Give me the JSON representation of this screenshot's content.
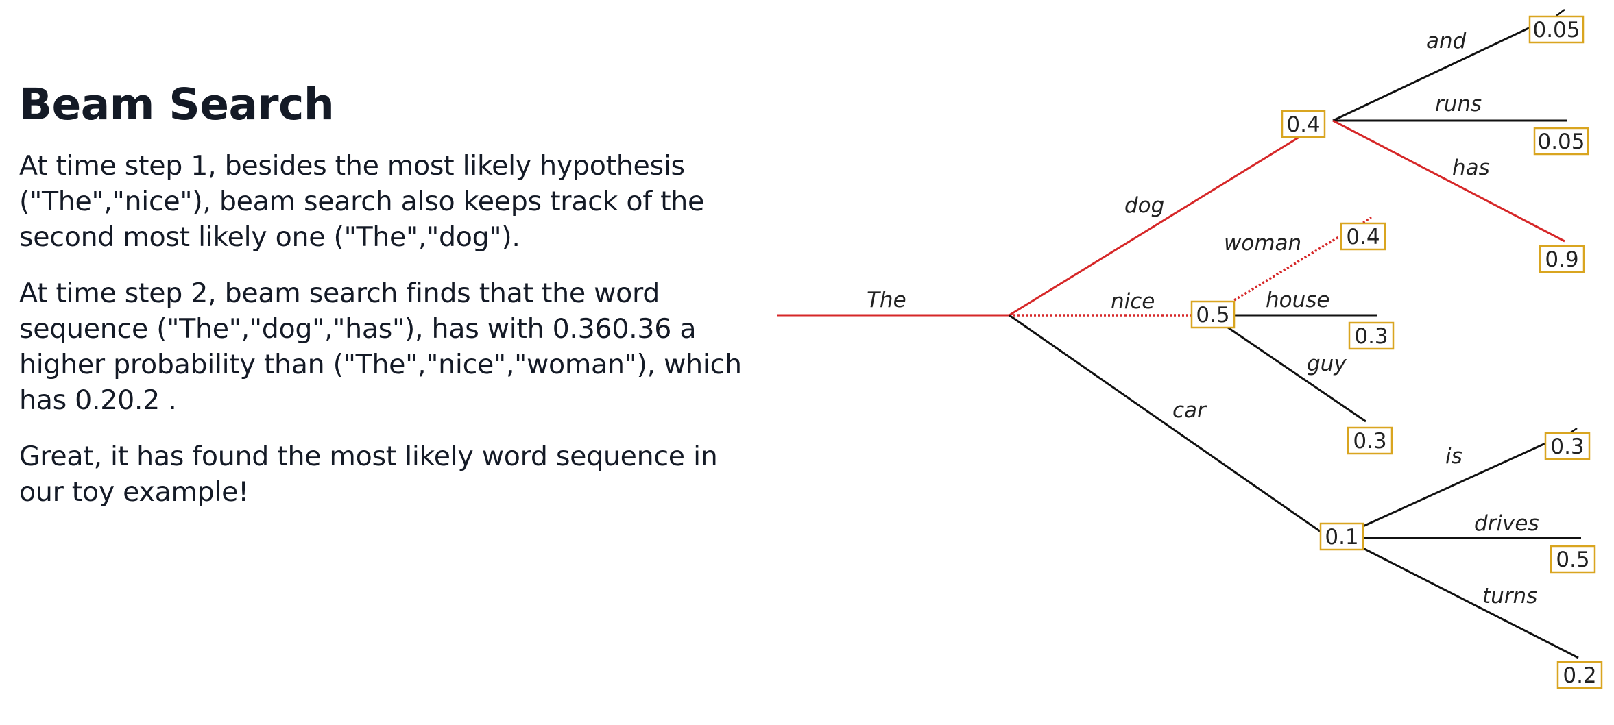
{
  "heading": "Beam Search",
  "paragraphs": [
    "At time step 1, besides the most likely hypothesis (\"The\",\"nice\"), beam search also keeps track of the second most likely one (\"The\",\"dog\").",
    "At time step 2, beam search finds that the word sequence (\"The\",\"dog\",\"has\"), has with 0.360.36 a higher probability than (\"The\",\"nice\",\"woman\"), which has 0.20.2 .",
    "Great, it has found the most likely word sequence in our toy example!"
  ],
  "tree": {
    "colors": {
      "chosen": "#d62728",
      "other": "#111111",
      "box_border": "#d9a520"
    },
    "root": {
      "word": "The"
    },
    "level1": [
      {
        "word": "dog",
        "prob": "0.4"
      },
      {
        "word": "nice",
        "prob": "0.5"
      },
      {
        "word": "car",
        "prob": "0.1"
      }
    ],
    "level2": {
      "dog": [
        {
          "word": "and",
          "prob": "0.05"
        },
        {
          "word": "runs",
          "prob": "0.05"
        },
        {
          "word": "has",
          "prob": "0.9"
        }
      ],
      "nice": [
        {
          "word": "woman",
          "prob": "0.4"
        },
        {
          "word": "house",
          "prob": "0.3"
        },
        {
          "word": "guy",
          "prob": "0.3"
        }
      ],
      "car": [
        {
          "word": "is",
          "prob": "0.3"
        },
        {
          "word": "drives",
          "prob": "0.5"
        },
        {
          "word": "turns",
          "prob": "0.2"
        }
      ]
    }
  }
}
